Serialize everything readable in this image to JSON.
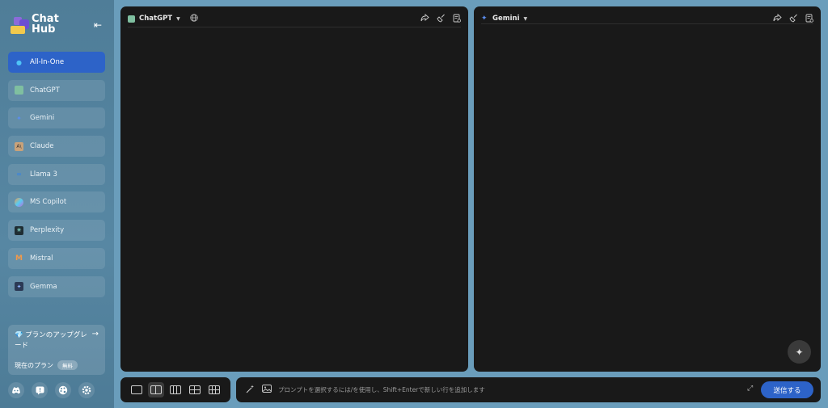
{
  "app": {
    "logo_line1": "Chat",
    "logo_line2": "Hub"
  },
  "sidebar": {
    "items": [
      {
        "label": "All-In-One",
        "icon": "all-in-one-icon",
        "color": "#4fc3f7",
        "active": true
      },
      {
        "label": "ChatGPT",
        "icon": "chatgpt-icon",
        "color": "#7fbfa0"
      },
      {
        "label": "Gemini",
        "icon": "gemini-icon",
        "color": "#5b8def"
      },
      {
        "label": "Claude",
        "icon": "claude-icon",
        "color": "#c8a27a"
      },
      {
        "label": "Llama 3",
        "icon": "llama-icon",
        "color": "#2f80ed"
      },
      {
        "label": "MS Copilot",
        "icon": "copilot-icon",
        "color": "#f2994a"
      },
      {
        "label": "Perplexity",
        "icon": "perplexity-icon",
        "color": "#1f2d33"
      },
      {
        "label": "Mistral",
        "icon": "mistral-icon",
        "color": "#f2994a"
      },
      {
        "label": "Gemma",
        "icon": "gemma-icon",
        "color": "#2b3a55"
      }
    ],
    "upgrade": {
      "title": "プランのアップグレード",
      "current_plan_label": "現在のプラン",
      "plan_badge": "無料"
    }
  },
  "panels": {
    "left": {
      "model": "ChatGPT",
      "icon_color": "#7fbfa0"
    },
    "right": {
      "model": "Gemini",
      "icon_color": "#5b8def"
    }
  },
  "input": {
    "placeholder": "プロンプトを選択するには/を使用し、Shift+Enterで新しい行を追加します",
    "send_label": "送信する"
  },
  "colors": {
    "accent": "#2d63c8",
    "panel_bg": "#191919",
    "page_bg": "#6a9dbb"
  }
}
